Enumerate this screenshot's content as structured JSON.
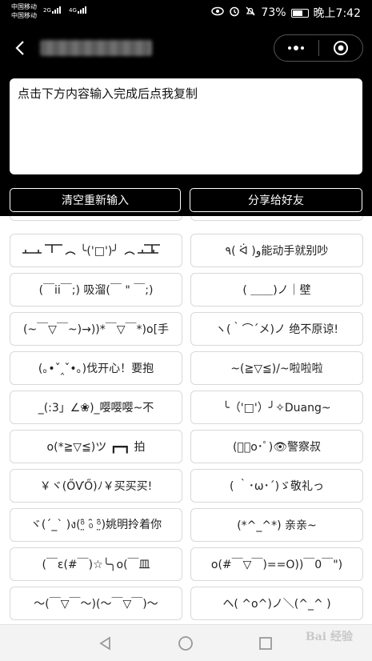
{
  "status_bar": {
    "carrier_1": "中国移动",
    "carrier_2": "中国移动",
    "net_1": "2G",
    "net_2": "4G",
    "battery_percent": "73%",
    "battery_level": 0.73,
    "time": "晚上7:42"
  },
  "textbox": {
    "text": "点击下方内容输入完成后点我复制"
  },
  "buttons": {
    "clear": "清空重新输入",
    "share": "分享给好友"
  },
  "emoticons": {
    "left": [
      "(￣ii￣;) 吸溜(￣ \" ￣;)",
      "(~￣▽￣~)→))*￣▽￣*)o[手",
      "(｡•ˇ‸ˇ•｡)伐开心！要抱",
      "_(:3」∠❀)_嘤嘤嘤~不",
      "o(*≧▽≦)ツ ┏━┓ 拍",
      "￥ヾ(ŐѴŐ)ﾉ￥买买买!",
      "ヾ(´_` )ง(ᵒ̤̑ ₀̑ ᵒ̤̑)姚明拎着你",
      "(￣ε(#￣)☆╰╮o(￣皿",
      "～(￣▽￣～)(～￣▽￣)～"
    ],
    "right": [
      "٩( ᐛ )و能动手就别吵",
      "( ＿＿)ノ｜壁",
      "ヽ(｀⌒´メ)ノ 绝不原谅!",
      "~(≧▽≦)/~啦啦啦",
      "╰（'□'）╯✧Duang~",
      "(ﾟ･o･ﾟ)👁警察叔",
      "( ｀･ω･´)ゞ敬礼っ",
      "(*^_^*) 亲亲~",
      "o(#￣▽￣)==O))￣0￣\")",
      "ヘ( ^o^)ノ＼(^_^ )"
    ]
  },
  "watermark": "Bai 经验"
}
